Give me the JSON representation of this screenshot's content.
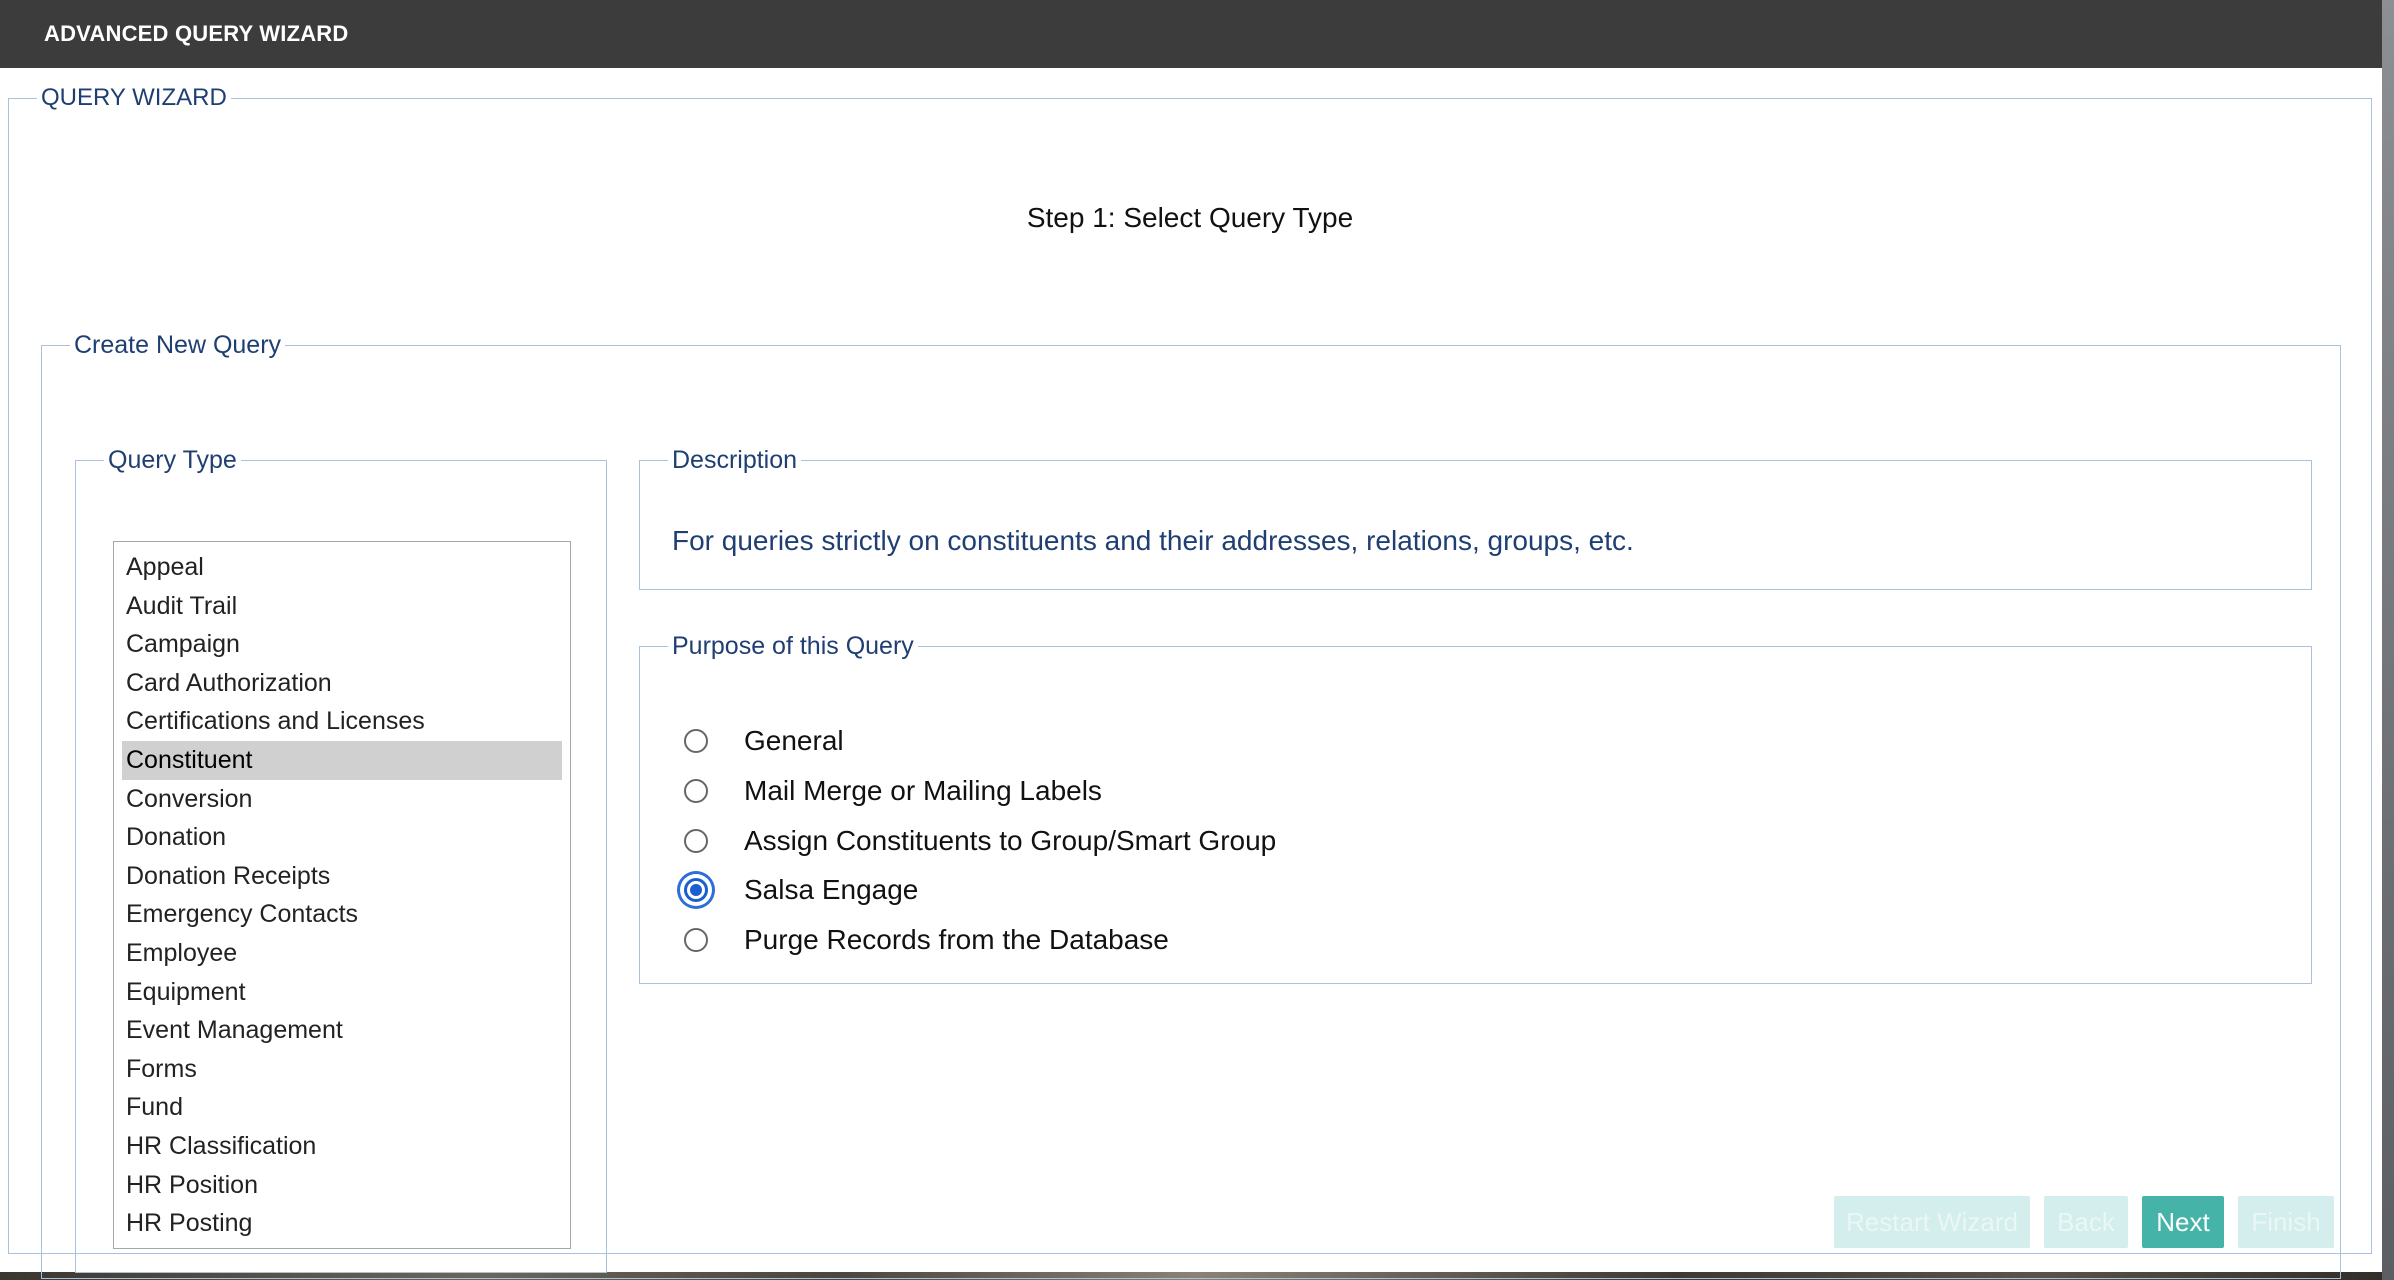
{
  "window": {
    "title": "ADVANCED QUERY WIZARD"
  },
  "wizard": {
    "legend": "QUERY WIZARD",
    "step_title": "Step 1: Select Query Type",
    "create": {
      "legend": "Create New Query",
      "query_type": {
        "legend": "Query Type",
        "items": [
          "Appeal",
          "Audit Trail",
          "Campaign",
          "Card Authorization",
          "Certifications and Licenses",
          "Constituent",
          "Conversion",
          "Donation",
          "Donation Receipts",
          "Emergency Contacts",
          "Employee",
          "Equipment",
          "Event Management",
          "Forms",
          "Fund",
          "HR Classification",
          "HR Position",
          "HR Posting"
        ],
        "selected": "Constituent"
      },
      "description": {
        "legend": "Description",
        "text": "For queries strictly on constituents and their addresses, relations, groups, etc."
      },
      "purpose": {
        "legend": "Purpose of this Query",
        "options": [
          "General",
          "Mail Merge or Mailing Labels",
          "Assign Constituents to Group/Smart Group",
          "Salsa Engage",
          "Purge Records from the Database"
        ],
        "selected": "Salsa Engage"
      }
    },
    "buttons": {
      "restart": "Restart Wizard",
      "back": "Back",
      "next": "Next",
      "finish": "Finish"
    }
  },
  "colors": {
    "titlebar": "#3c3c3c",
    "legend_text": "#1f3f73",
    "fieldset_border": "#a9c1da",
    "primary_button": "#45b3a8",
    "disabled_button": "#d3eeec",
    "selected_item": "#d0d0d0",
    "radio_checked": "#1a5fd0"
  }
}
